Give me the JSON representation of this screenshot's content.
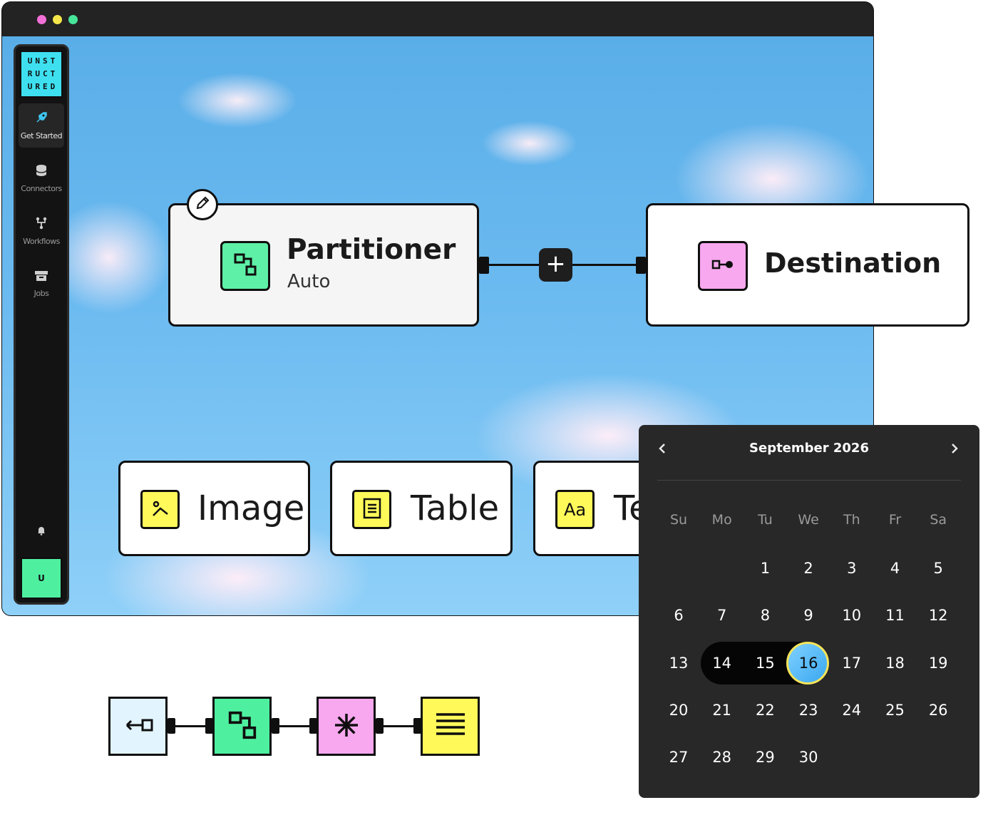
{
  "sidebar": {
    "logo": [
      "UNST",
      "RUCT",
      "URED"
    ],
    "items": [
      {
        "label": "Get Started",
        "icon": "rocket-icon",
        "active": true
      },
      {
        "label": "Connectors",
        "icon": "database-icon",
        "active": false
      },
      {
        "label": "Workflows",
        "icon": "workflow-icon",
        "active": false
      },
      {
        "label": "Jobs",
        "icon": "jobs-icon",
        "active": false
      }
    ],
    "avatar": "U"
  },
  "canvas": {
    "partitioner": {
      "title": "Partitioner",
      "subtitle": "Auto"
    },
    "add_button": "+",
    "destination": {
      "title": "Destination"
    },
    "elements": [
      {
        "label": "Image",
        "icon": "image-icon"
      },
      {
        "label": "Table",
        "icon": "table-icon"
      },
      {
        "label": "Te",
        "icon_text": "Aa",
        "icon": "text-icon"
      }
    ]
  },
  "calendar": {
    "title": "September 2026",
    "weekdays": [
      "Su",
      "Mo",
      "Tu",
      "We",
      "Th",
      "Fr",
      "Sa"
    ],
    "weeks": [
      [
        "",
        "",
        "1",
        "2",
        "3",
        "4",
        "5"
      ],
      [
        "6",
        "7",
        "8",
        "9",
        "10",
        "11",
        "12"
      ],
      [
        "13",
        "14",
        "15",
        "16",
        "17",
        "18",
        "19"
      ],
      [
        "20",
        "21",
        "22",
        "23",
        "24",
        "25",
        "26"
      ],
      [
        "27",
        "28",
        "29",
        "30",
        "",
        "",
        ""
      ]
    ],
    "range_start": "14",
    "selected": "16"
  },
  "chain": {
    "colors": [
      "#e2f4fd",
      "#4ef0a0",
      "#f7a8ee",
      "#fff95a"
    ],
    "icons": [
      "source-connector-icon",
      "partition-icon",
      "enrich-icon",
      "chunk-icon"
    ]
  },
  "colors": {
    "accent_green": "#5ef0a6",
    "accent_pink": "#f7a8ee",
    "accent_yellow": "#fff95a",
    "accent_cyan": "#3ee0f0"
  }
}
